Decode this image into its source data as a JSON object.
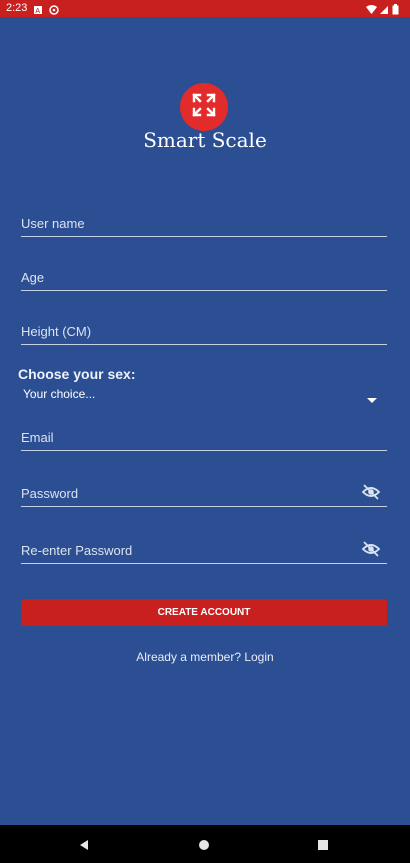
{
  "status_bar": {
    "time": "2:23",
    "icons": [
      "sim-card-icon",
      "location-icon",
      "wifi-icon",
      "signal-icon",
      "battery-icon"
    ]
  },
  "app": {
    "name": "Smart Scale",
    "logo_icon": "expand-arrows-icon",
    "accent_color": "#c8201e",
    "background_color": "#2c4f93"
  },
  "form": {
    "username_label": "User name",
    "age_label": "Age",
    "height_label": "Height (CM)",
    "sex_heading": "Choose your sex:",
    "sex_select_value": "Your choice...",
    "email_label": "Email",
    "password_label": "Password",
    "reenter_password_label": "Re-enter Password"
  },
  "actions": {
    "create_account_label": "CREATE ACCOUNT",
    "login_link_label": "Already a member? Login"
  },
  "nav": {
    "icons": [
      "back-icon",
      "home-icon",
      "recents-icon"
    ]
  }
}
